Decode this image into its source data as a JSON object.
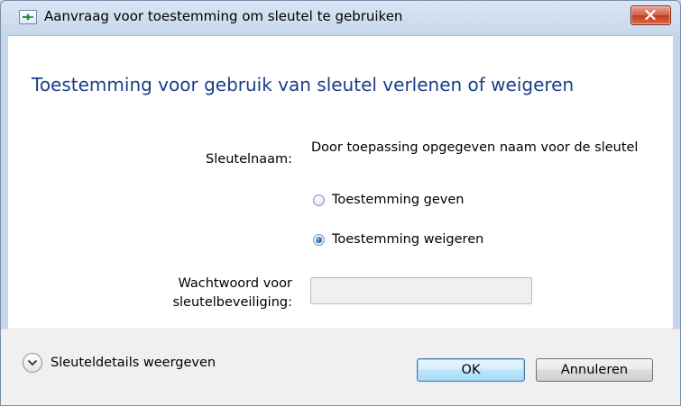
{
  "window": {
    "title": "Aanvraag voor toestemming om sleutel te gebruiken",
    "icon": "key-arrow-icon",
    "close_icon": "close-icon"
  },
  "main": {
    "heading": "Toestemming voor gebruik van sleutel verlenen of weigeren",
    "key_name_label": "Sleutelnaam:",
    "key_name_value": "Door toepassing opgegeven naam voor de sleutel",
    "options": [
      {
        "label": "Toestemming geven",
        "checked": false
      },
      {
        "label": "Toestemming weigeren",
        "checked": true
      }
    ],
    "password_label": "Wachtwoord voor sleutelbeveiliging:",
    "password_value": ""
  },
  "footer": {
    "details_label": "Sleuteldetails weergeven",
    "ok_label": "OK",
    "cancel_label": "Annuleren"
  },
  "colors": {
    "heading": "#1a3e8c",
    "chrome": "#cfdcec",
    "close_button": "#c23a1e"
  }
}
